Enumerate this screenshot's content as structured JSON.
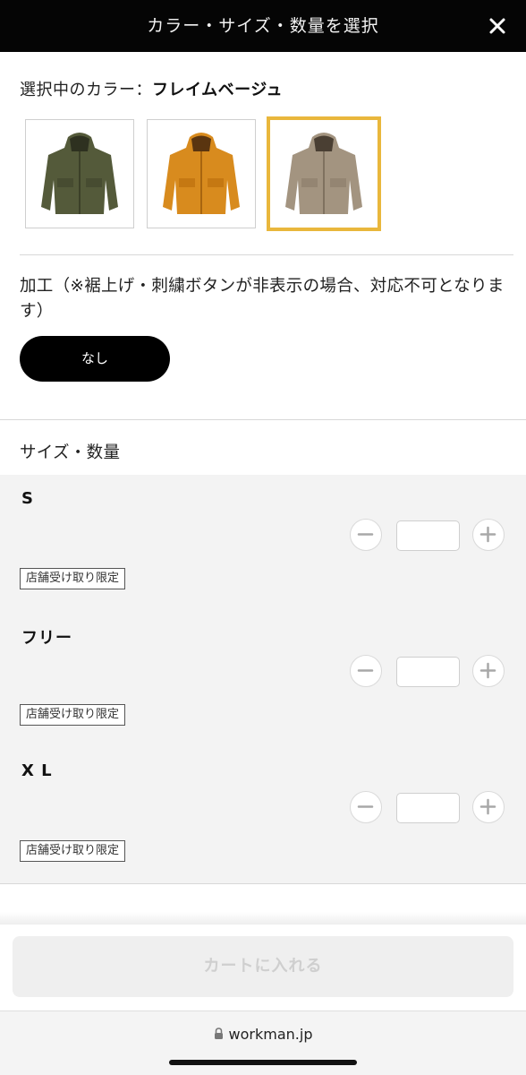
{
  "header": {
    "title": "カラー・サイズ・数量を選択",
    "close_icon": "close-icon"
  },
  "color": {
    "label_prefix": "選択中のカラー：",
    "selected_name": "フレイムベージュ",
    "swatches": [
      {
        "name": "olive",
        "color": "#5a5a3c",
        "selected": false
      },
      {
        "name": "orange",
        "color": "#d08a22",
        "selected": false
      },
      {
        "name": "beige",
        "color": "#a49480",
        "selected": true
      }
    ],
    "selected_border_color": "#e9b73c"
  },
  "processing": {
    "label": "加工（※裾上げ・刺繍ボタンが非表示の場合、対応不可となります）",
    "option_label": "なし"
  },
  "sizes": {
    "title": "サイズ・数量",
    "rows": [
      {
        "name": "S",
        "quantity": "",
        "tag": "店舗受け取り限定"
      },
      {
        "name": "フリー",
        "quantity": "",
        "tag": "店舗受け取り限定"
      },
      {
        "name": "X L",
        "quantity": "",
        "tag": "店舗受け取り限定"
      }
    ]
  },
  "cart": {
    "button_label": "カートに入れる"
  },
  "browser": {
    "url": "workman.jp",
    "lock_icon": "lock-icon"
  }
}
